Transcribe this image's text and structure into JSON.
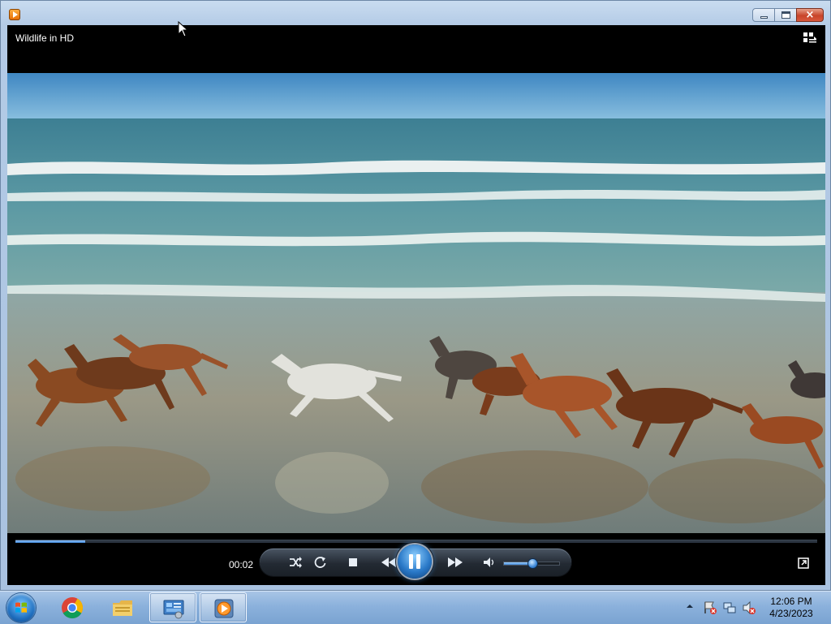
{
  "window": {
    "title": "Wildlife in HD",
    "buttons": {
      "minimize": "minimize",
      "maximize": "maximize",
      "close": "×"
    }
  },
  "player": {
    "elapsed": "00:02",
    "seek_progress": 0.087,
    "volume_level": 0.5,
    "state": "playing"
  },
  "taskbar": {
    "items": [
      {
        "name": "chrome-icon"
      },
      {
        "name": "file-explorer-icon"
      },
      {
        "name": "control-panel-icon"
      },
      {
        "name": "windows-media-player-icon"
      }
    ],
    "clock": {
      "time": "12:06 PM",
      "date": "4/23/2023"
    }
  },
  "colors": {
    "accent": "#3f86d6",
    "close_red": "#c8442a",
    "taskbar": "#8bb1dc"
  }
}
